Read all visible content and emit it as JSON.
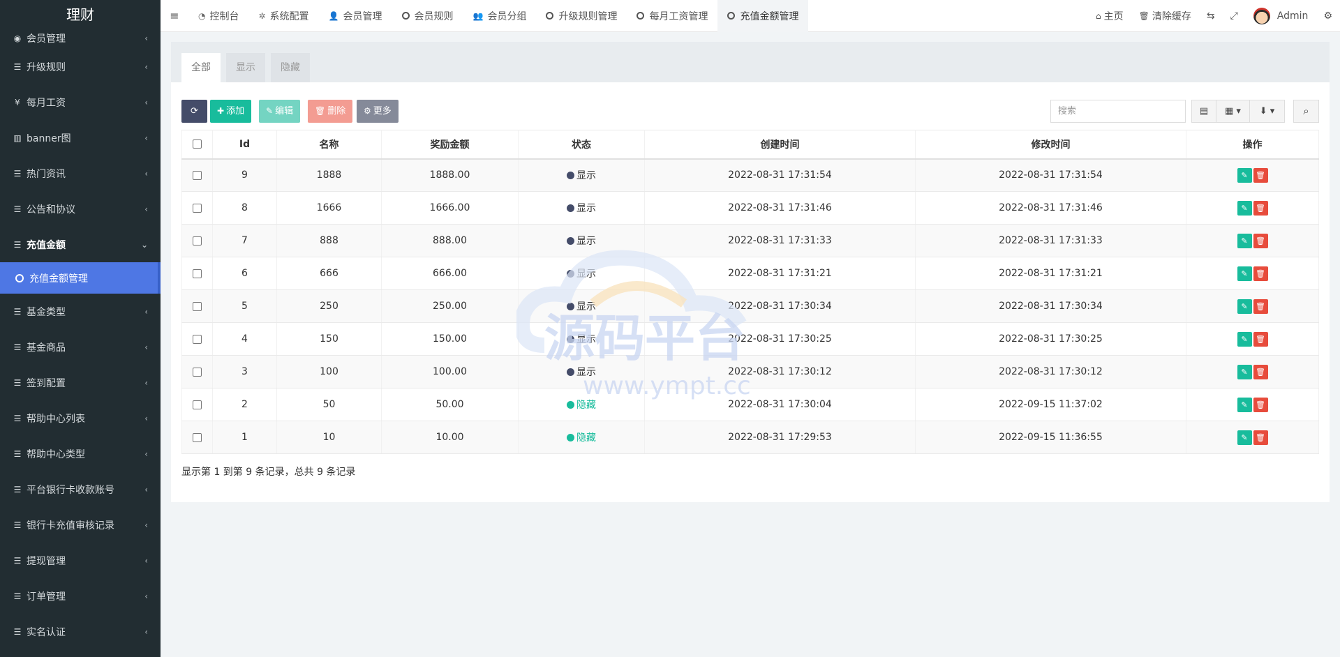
{
  "brand": "理财",
  "sidebar": {
    "items": [
      {
        "label": "会员管理",
        "icon": "user-circle-icon",
        "glyph": "◉",
        "caret": "‹"
      },
      {
        "label": "升级规则",
        "icon": "list-icon",
        "glyph": "☰",
        "caret": "‹"
      },
      {
        "label": "每月工资",
        "icon": "yen-icon",
        "glyph": "¥",
        "caret": "‹"
      },
      {
        "label": "banner图",
        "icon": "columns-icon",
        "glyph": "▥",
        "caret": "‹"
      },
      {
        "label": "热门资讯",
        "icon": "list-icon",
        "glyph": "☰",
        "caret": "‹"
      },
      {
        "label": "公告和协议",
        "icon": "list-icon",
        "glyph": "☰",
        "caret": "‹"
      },
      {
        "label": "充值金额",
        "icon": "list-icon",
        "glyph": "☰",
        "caret": "⌄"
      },
      {
        "label": "基金类型",
        "icon": "list-icon",
        "glyph": "☰",
        "caret": "‹"
      },
      {
        "label": "基金商品",
        "icon": "list-icon",
        "glyph": "☰",
        "caret": "‹"
      },
      {
        "label": "签到配置",
        "icon": "list-icon",
        "glyph": "☰",
        "caret": "‹"
      },
      {
        "label": "帮助中心列表",
        "icon": "list-icon",
        "glyph": "☰",
        "caret": "‹"
      },
      {
        "label": "帮助中心类型",
        "icon": "list-icon",
        "glyph": "☰",
        "caret": "‹"
      },
      {
        "label": "平台银行卡收款账号",
        "icon": "list-icon",
        "glyph": "☰",
        "caret": "‹"
      },
      {
        "label": "银行卡充值审核记录",
        "icon": "list-icon",
        "glyph": "☰",
        "caret": "‹"
      },
      {
        "label": "提现管理",
        "icon": "list-icon",
        "glyph": "☰",
        "caret": "‹"
      },
      {
        "label": "订单管理",
        "icon": "list-icon",
        "glyph": "☰",
        "caret": "‹"
      },
      {
        "label": "实名认证",
        "icon": "list-icon",
        "glyph": "☰",
        "caret": "‹"
      }
    ],
    "active_sub": "充值金额管理"
  },
  "topnav": {
    "menu_glyph": "≡",
    "tabs": [
      {
        "label": "控制台",
        "glyph": "◔"
      },
      {
        "label": "系统配置",
        "glyph": "✲"
      },
      {
        "label": "会员管理",
        "glyph": "👤"
      },
      {
        "label": "会员规则",
        "glyph": ""
      },
      {
        "label": "会员分组",
        "glyph": "👥"
      },
      {
        "label": "升级规则管理",
        "glyph": ""
      },
      {
        "label": "每月工资管理",
        "glyph": ""
      },
      {
        "label": "充值金额管理",
        "glyph": ""
      }
    ],
    "home": "主页",
    "home_glyph": "⌂",
    "clear_cache": "清除缓存",
    "trash_glyph": "🗑",
    "translate_glyph": "⇆",
    "fullscreen_glyph": "⤢",
    "user": "Admin",
    "settings_glyph": "⚙"
  },
  "panel": {
    "tabs": [
      "全部",
      "显示",
      "隐藏"
    ]
  },
  "toolbar": {
    "refresh_glyph": "⟳",
    "add_glyph": "✚",
    "add": "添加",
    "edit_glyph": "✎",
    "edit": "编辑",
    "delete_glyph": "🗑",
    "delete": "删除",
    "more_glyph": "⚙",
    "more": "更多",
    "search_placeholder": "搜索",
    "view_glyph": "▤",
    "columns_glyph": "▦ ▾",
    "export_glyph": "⬇ ▾",
    "search_glyph": "⌕"
  },
  "table": {
    "headers": [
      "Id",
      "名称",
      "奖励金额",
      "状态",
      "创建时间",
      "修改时间",
      "操作"
    ],
    "rows": [
      {
        "id": "9",
        "name": "1888",
        "amount": "1888.00",
        "status": "显示",
        "created": "2022-08-31 17:31:54",
        "updated": "2022-08-31 17:31:54"
      },
      {
        "id": "8",
        "name": "1666",
        "amount": "1666.00",
        "status": "显示",
        "created": "2022-08-31 17:31:46",
        "updated": "2022-08-31 17:31:46"
      },
      {
        "id": "7",
        "name": "888",
        "amount": "888.00",
        "status": "显示",
        "created": "2022-08-31 17:31:33",
        "updated": "2022-08-31 17:31:33"
      },
      {
        "id": "6",
        "name": "666",
        "amount": "666.00",
        "status": "显示",
        "created": "2022-08-31 17:31:21",
        "updated": "2022-08-31 17:31:21"
      },
      {
        "id": "5",
        "name": "250",
        "amount": "250.00",
        "status": "显示",
        "created": "2022-08-31 17:30:34",
        "updated": "2022-08-31 17:30:34"
      },
      {
        "id": "4",
        "name": "150",
        "amount": "150.00",
        "status": "显示",
        "created": "2022-08-31 17:30:25",
        "updated": "2022-08-31 17:30:25"
      },
      {
        "id": "3",
        "name": "100",
        "amount": "100.00",
        "status": "显示",
        "created": "2022-08-31 17:30:12",
        "updated": "2022-08-31 17:30:12"
      },
      {
        "id": "2",
        "name": "50",
        "amount": "50.00",
        "status": "隐藏",
        "created": "2022-08-31 17:30:04",
        "updated": "2022-09-15 11:37:02"
      },
      {
        "id": "1",
        "name": "10",
        "amount": "10.00",
        "status": "隐藏",
        "created": "2022-08-31 17:29:53",
        "updated": "2022-09-15 11:36:55"
      }
    ],
    "edit_glyph": "✎",
    "delete_glyph": "🗑",
    "summary": "显示第 1 到第 9 条记录，总共 9 条记录"
  },
  "watermark": {
    "title": "源码平台",
    "url": "www.ympt.cc"
  },
  "colors": {
    "sidebar_bg": "#222d32",
    "active_blue": "#4e77e4",
    "refresh_btn": "#444c69",
    "add_btn": "#18bc9c",
    "edit_btn": "#74d4c2",
    "delete_btn": "#f39c92",
    "more_btn": "#858a99",
    "status_show": "#444c69",
    "status_hide": "#18bc9c",
    "op_edit": "#18bc9c",
    "op_delete": "#e74c3c"
  }
}
